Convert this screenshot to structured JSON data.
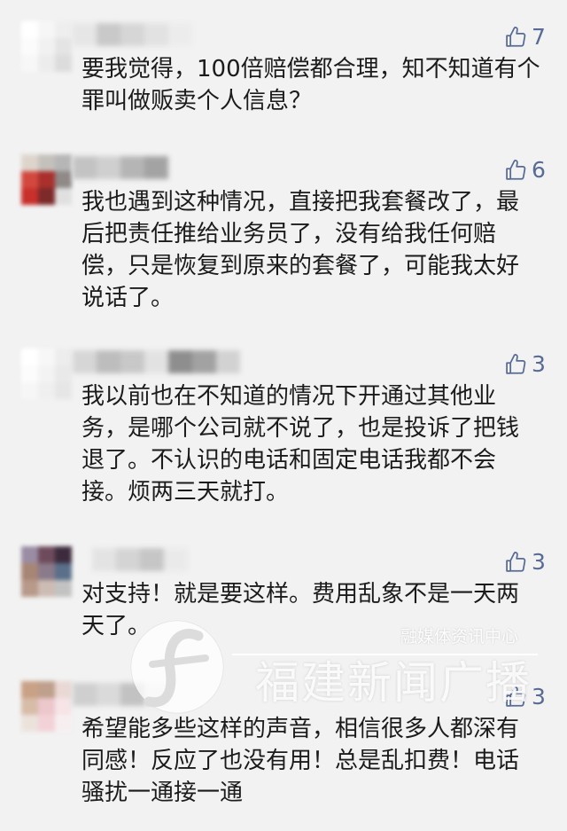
{
  "colors": {
    "background": "#f2f2f2",
    "text": "#1b1b1b",
    "like": "#576b95",
    "watermark": "#ffffff"
  },
  "icons": {
    "like": "thumbs-up-icon",
    "logo": "fujian-news-radio-logo-icon"
  },
  "comments": [
    {
      "likes": "7",
      "lines": [
        "要我觉得，100倍赔偿都合理，知不知道有个",
        "罪叫做贩卖个人信息？"
      ],
      "avatar_colors": [
        "#ffffff",
        "#f6f6f6",
        "#eeeeee",
        "#fbfbfb",
        "#f1f1f1",
        "#e4e4e4",
        "#f7f7f7",
        "#ececec",
        "#dcdcdc"
      ],
      "name_colors": [
        "#e6e6e6",
        "#c9c9c9",
        "#d6d6d6",
        "#e2e2e2",
        "#ececec"
      ]
    },
    {
      "likes": "6",
      "lines": [
        "我也遇到这种情况，直接把我套餐改了，最",
        "后把责任推给业务员了，没有给我任何赔",
        "偿，只是恢复到原来的套餐了，可能我太好",
        "说话了。"
      ],
      "avatar_colors": [
        "#ddd5cc",
        "#c4c1bd",
        "#b6b6b6",
        "#d2483f",
        "#a9302d",
        "#8f8a88",
        "#c8302c",
        "#7c2a2a",
        "#e0e0e0"
      ],
      "name_colors": [
        "#c3c3c3",
        "#cfcfcf",
        "#b5b5b5",
        "#a3a3a3"
      ]
    },
    {
      "likes": "3",
      "lines": [
        "我以前也在不知道的情况下开通过其他业",
        "务，是哪个公司就不说了，也是投诉了把钱",
        "退了。不认识的电话和固定电话我都不会",
        "接。烦两三天就打。"
      ],
      "avatar_colors": [
        "#ffffff",
        "#f7f7f7",
        "#ededed",
        "#fcfcfc",
        "#f3f3f3",
        "#e9e9e9",
        "#f6f6f6",
        "#efefef",
        "#e6e6e6"
      ],
      "name_colors": [
        "#d6d6d6",
        "#bdbdbd",
        "#c8c8c8",
        "#e2e2e2",
        "#8e8e8e",
        "#a2a2a2",
        "#d2d2d2"
      ]
    },
    {
      "likes": "3",
      "lines": [
        "对支持！就是要这样。费用乱象不是一天两",
        "天了。"
      ],
      "avatar_colors": [
        "#9a8ca3",
        "#6e4b5c",
        "#3c2b3c",
        "#a88676",
        "#8a7a8a",
        "#5a6f8a",
        "#b8998a",
        "#cdbcb4",
        "#c2c2c2"
      ],
      "name_colors": [
        "#e3e3e3",
        "#d4d4d4",
        "#c6c6c6",
        "#eaeaea"
      ]
    },
    {
      "likes": "3",
      "lines": [
        "希望能多些这样的声音，相信很多人都深有",
        "同感！反应了也没有用！总是乱扣费！电话",
        "骚扰一通接一通"
      ],
      "avatar_colors": [
        "#c9a186",
        "#bea08c",
        "#ead8d4",
        "#d7bca8",
        "#ecc7cc",
        "#f6e4e7",
        "#ece2dc",
        "#f2d2d7",
        "#f7eef0"
      ],
      "name_colors": [
        "#cfcfcf",
        "#dadada",
        "#c2c2c2",
        "#e4e4e4"
      ]
    }
  ],
  "watermark": {
    "subtitle": "融媒体资讯中心",
    "title": "福建新闻广播"
  }
}
